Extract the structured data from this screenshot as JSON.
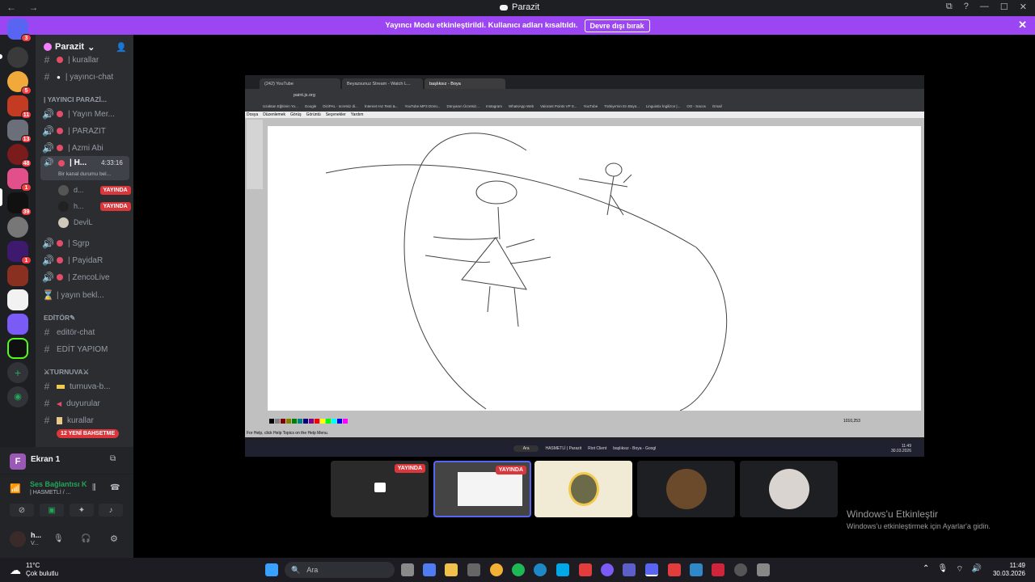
{
  "window": {
    "title": "Parazit",
    "nav": "← →",
    "controls": [
      "⧉",
      "?",
      "—",
      "☐",
      "✕"
    ]
  },
  "notice": {
    "text": "Yayıncı Modu etkinleştirildi. Kullanıcı adları kısaltıldı.",
    "button": "Devre dışı bırak",
    "close": "✕"
  },
  "guild_badges": [
    "3",
    "5",
    "11",
    "13",
    "48",
    "1",
    "39",
    "1"
  ],
  "server": {
    "name": "Parazit",
    "chevron": "⌄",
    "invite_icon": "👤"
  },
  "channels": [
    {
      "prefix": "#",
      "label": "| kurallar"
    },
    {
      "prefix": "#",
      "label": "| yayıncı-chat"
    },
    {
      "category": "| YAYINCI PARAZİ..."
    },
    {
      "prefix": "🔊",
      "label": "| Yayın Mer..."
    },
    {
      "prefix": "🔊",
      "label": "| PARAZIT"
    },
    {
      "prefix": "🔊",
      "label": "| Azmi Abi"
    },
    {
      "prefix": "🔊",
      "label": "| H...",
      "time": "4:33:16",
      "status": "Bir kanal durumu bel..."
    },
    {
      "prefix": "🔊",
      "label": "| Sgrp"
    },
    {
      "prefix": "🔊",
      "label": "| PayidaR"
    },
    {
      "prefix": "🔊",
      "label": "| ZencoLive"
    },
    {
      "prefix": "⌛",
      "label": "| yayın bekl..."
    },
    {
      "category": "EDİTÖR✎"
    },
    {
      "prefix": "#",
      "label": "editör-chat"
    },
    {
      "prefix": "#",
      "label": "EDİT YAPIOM"
    },
    {
      "category": "⚔TURNUVA⚔"
    },
    {
      "prefix": "#",
      "label": "turnuva-b..."
    },
    {
      "prefix": "#",
      "label": "duyurular"
    },
    {
      "prefix": "#",
      "label": "kurallar"
    }
  ],
  "voice_members": [
    {
      "name": "d...",
      "badge": "YAYINDA"
    },
    {
      "name": "h...",
      "badge": "YAYINDA"
    },
    {
      "name": "DevİL",
      "badge": ""
    }
  ],
  "new_pill": "12 YENİ BAHSETME",
  "panel": {
    "screen_label": "Ekran 1",
    "screen_initial": "F",
    "connection": "Ses Bağlantısı K",
    "connection_sub": "| HASMETLİ / ...",
    "user_name": "h...",
    "user_sub": "V..."
  },
  "shared_screen": {
    "tabs": [
      "(242) YouTube",
      "Beyazsunuz Stream - Watch L...",
      "başlıksız - Boya"
    ],
    "url": "paint.js.org",
    "bookmarks": [
      "Uzaktan Eğitimin Yo...",
      "Google",
      "DiziPAL - ücretsiz di...",
      "İnternet Hız Testi &...",
      "YouTube MP3 Dönü...",
      "Dünyanın Ücretsiz...",
      "Instagram",
      "WhatsApp Web",
      "Valorant Points VP S...",
      "YouTube",
      "Türkiye'nin En Büyü...",
      "Linguistix İngilizce |...",
      "OG - Sacos",
      "Gmail"
    ],
    "menu": [
      "Dosya",
      "Düzenlemek",
      "Görüş",
      "Görüntü",
      "Seçenekler",
      "Yardım"
    ],
    "status": "For Help, click Help Topics on the Help Menu.",
    "coords": "1010,253",
    "taskbar_items": [
      "Ara",
      "HASMETLİ | Parazit",
      "Riot Client",
      "başlıksız - Boya - Googl"
    ],
    "clock": "11:49",
    "date": "30.03.2026"
  },
  "thumbs_live": [
    "YAYINDA",
    "YAYINDA"
  ],
  "watermark": {
    "title": "Windows'u Etkinleştir",
    "sub": "Windows'u etkinleştirmek için Ayarlar'a gidin."
  },
  "taskbar": {
    "weather_temp": "11°C",
    "weather_desc": "Çok bulutlu",
    "search": "Ara",
    "time": "11:49",
    "date": "30.03.2026"
  }
}
